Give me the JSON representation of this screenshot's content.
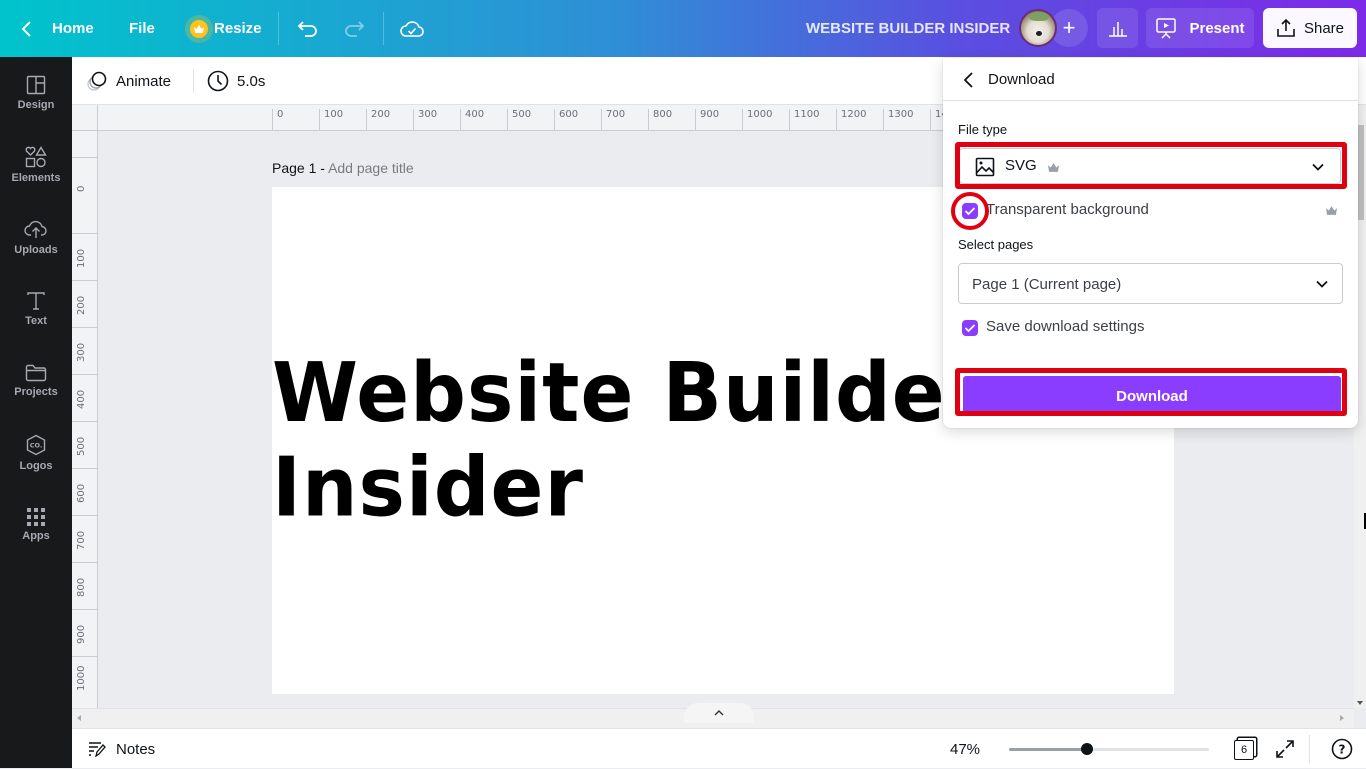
{
  "topbar": {
    "home_label": "Home",
    "file_label": "File",
    "resize_label": "Resize",
    "design_title": "WEBSITE BUILDER INSIDER",
    "present_label": "Present",
    "share_label": "Share"
  },
  "sidebar": {
    "items": [
      {
        "label": "Design",
        "icon": "layout-icon"
      },
      {
        "label": "Elements",
        "icon": "shapes-icon"
      },
      {
        "label": "Uploads",
        "icon": "cloud-upload-icon"
      },
      {
        "label": "Text",
        "icon": "text-icon"
      },
      {
        "label": "Projects",
        "icon": "folder-icon"
      },
      {
        "label": "Logos",
        "icon": "logo-hexagon-icon"
      },
      {
        "label": "Apps",
        "icon": "grid-icon"
      }
    ]
  },
  "toolbar": {
    "animate_label": "Animate",
    "duration_label": "5.0s"
  },
  "rulers": {
    "horizontal": [
      "0",
      "100",
      "200",
      "300",
      "400",
      "500",
      "600",
      "700",
      "800",
      "900",
      "1000",
      "1100",
      "1200",
      "1300",
      "14"
    ],
    "vertical": [
      "0",
      "100",
      "200",
      "300",
      "400",
      "500",
      "600",
      "700",
      "800",
      "900",
      "1000"
    ]
  },
  "canvas": {
    "page_number_label": "Page 1 -",
    "page_title_placeholder": "Add page title",
    "page_text": "Website Builder Insider"
  },
  "download_panel": {
    "title": "Download",
    "file_type_label": "File type",
    "file_type_value": "SVG",
    "transparent_background_label": "Transparent background",
    "transparent_background_checked": true,
    "select_pages_label": "Select pages",
    "select_pages_value": "Page 1 (Current page)",
    "save_settings_label": "Save download settings",
    "save_settings_checked": true,
    "download_button_label": "Download"
  },
  "footer": {
    "notes_label": "Notes",
    "zoom_label": "47%",
    "zoom_slider_fraction": 0.39,
    "page_count": "6"
  },
  "colors": {
    "accent_purple": "#8b3dff",
    "highlight_red": "#e0000f",
    "sidebar_bg": "#18191b"
  }
}
